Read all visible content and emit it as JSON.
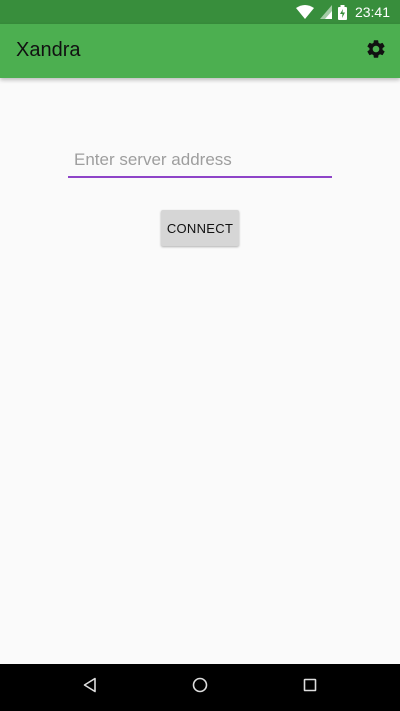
{
  "status_bar": {
    "time": "23:41",
    "icons": [
      "wifi-icon",
      "cell-signal-icon",
      "battery-charging-icon"
    ]
  },
  "app_bar": {
    "title": "Xandra",
    "action_icon": "gear-icon"
  },
  "main": {
    "server_input": {
      "value": "",
      "placeholder": "Enter server address"
    },
    "connect_label": "CONNECT"
  },
  "nav_bar": {
    "buttons": [
      "back-icon",
      "home-icon",
      "recents-icon"
    ]
  },
  "colors": {
    "status_bar": "#388e3c",
    "app_bar": "#4caf50",
    "accent": "#8e44c8",
    "background": "#fafafa",
    "button": "#d6d6d6",
    "nav_bar": "#000000"
  }
}
